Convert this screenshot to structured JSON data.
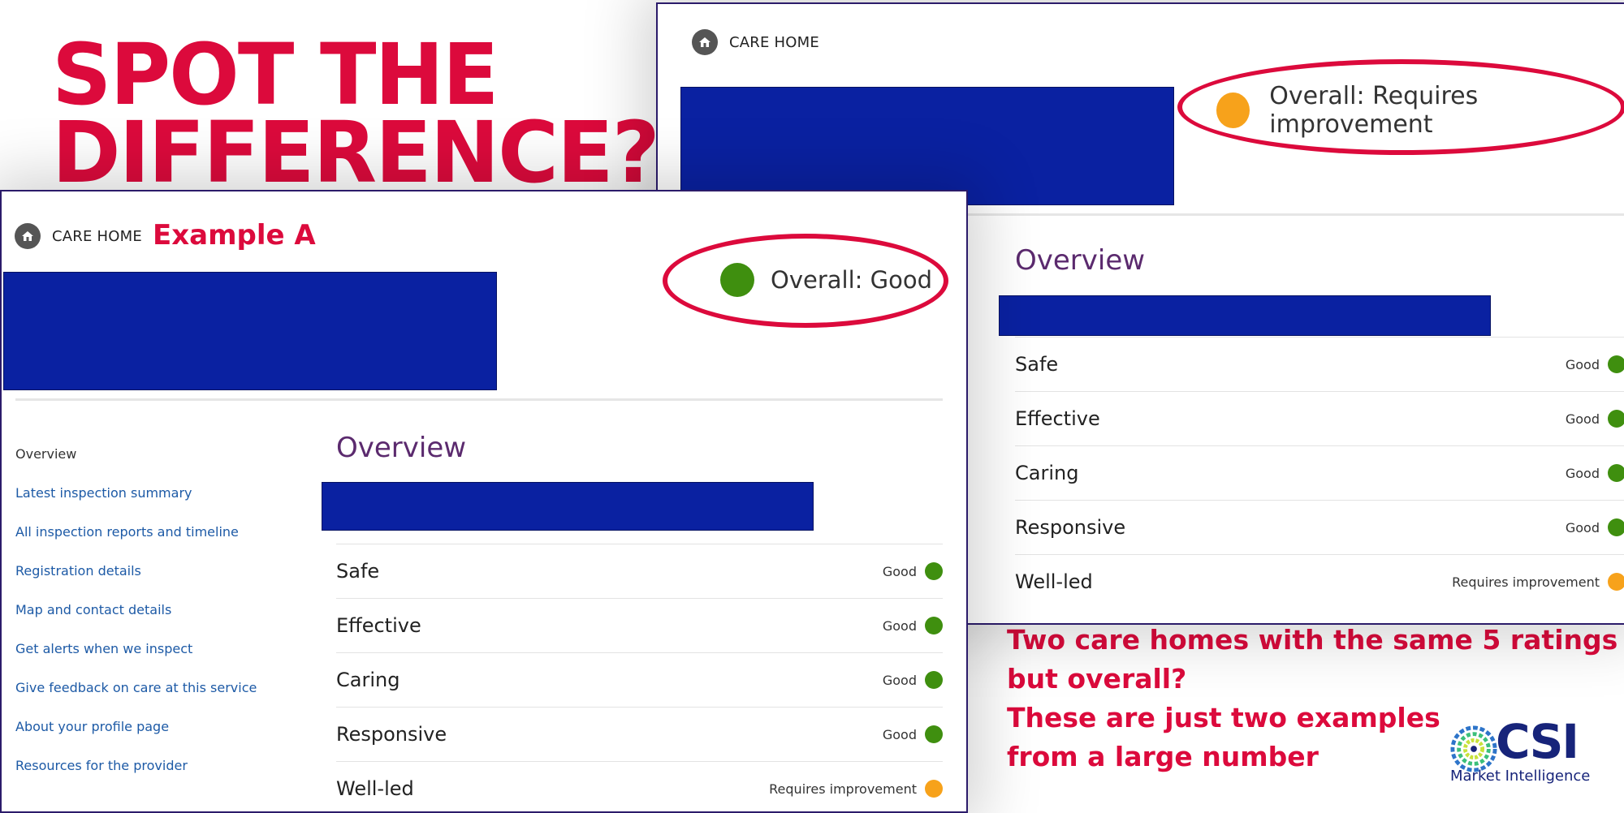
{
  "headline": "SPOT THE\nDIFFERENCE?",
  "colors": {
    "accent": "#dc0a3c",
    "redaction": "#0a21a1",
    "good": "#3f8f0f",
    "requires_improvement": "#f7a21b",
    "overview_title": "#5b2a6e",
    "nav_link": "#1d5aa6"
  },
  "example_a": {
    "service_type": "CARE HOME",
    "service_icon": "care-home-icon",
    "example_label": "Example A",
    "overall": "Overall: Good",
    "overall_status": "good",
    "overview_title": "Overview",
    "nav": [
      "Overview",
      "Latest inspection summary",
      "All inspection reports and timeline",
      "Registration details",
      "Map and contact details",
      "Get alerts when we inspect",
      "Give feedback on care at this service",
      "About your profile page",
      "Resources for the provider"
    ],
    "ratings": [
      {
        "name": "Safe",
        "value": "Good",
        "status": "good"
      },
      {
        "name": "Effective",
        "value": "Good",
        "status": "good"
      },
      {
        "name": "Caring",
        "value": "Good",
        "status": "good"
      },
      {
        "name": "Responsive",
        "value": "Good",
        "status": "good"
      },
      {
        "name": "Well-led",
        "value": "Requires improvement",
        "status": "requires_improvement"
      }
    ]
  },
  "example_b": {
    "service_type": "CARE HOME",
    "service_icon": "care-home-icon",
    "overall": "Overall: Requires improvement",
    "overall_status": "requires_improvement",
    "overview_title": "Overview",
    "ratings": [
      {
        "name": "Safe",
        "value": "Good",
        "status": "good"
      },
      {
        "name": "Effective",
        "value": "Good",
        "status": "good"
      },
      {
        "name": "Caring",
        "value": "Good",
        "status": "good"
      },
      {
        "name": "Responsive",
        "value": "Good",
        "status": "good"
      },
      {
        "name": "Well-led",
        "value": "Requires improvement",
        "status": "requires_improvement"
      }
    ]
  },
  "caption": [
    "Two care homes with the same 5 ratings",
    "but overall?",
    "These are just two examples",
    "from a large number"
  ],
  "logo": {
    "name": "CSI",
    "tagline": "Market Intelligence",
    "icon": "csi-logo-icon"
  }
}
